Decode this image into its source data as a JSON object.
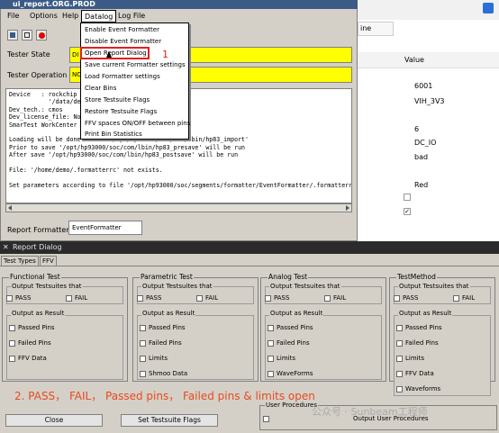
{
  "main_window": {
    "title": "ui_report.ORG.PROD",
    "menu": [
      "File",
      "Options",
      "Help",
      "Datalog",
      "Log File"
    ],
    "tester_state_label": "Tester State",
    "tester_state_value": "DI",
    "tester_operation_label": "Tester Operation",
    "tester_operation_value": "NO",
    "log_lines": [
      "Device   : rockchip on",
      "           '/data/dem",
      "Dev_tech.: cmos",
      "Dev_license_file: None",
      "SmarTest WorkCenter Re",
      "",
      "Loading will be done b  ...  /opt/hp93000/soc/com/lbin/hp83_import'",
      "Prior to save '/opt/hp93000/soc/com/lbin/hp83_presave' will be run",
      "After save '/opt/hp93000/soc/com/lbin/hp83_postsave' will be run",
      "",
      "File: '/home/demo/.formatterrc' not exists.",
      "",
      "Set parameters according to file '/opt/hp93000/soc/segments/formatter/EventFormatter/.formatterrc.dk"
    ],
    "report_formatter_label": "Report Formatter",
    "report_formatter_value": "EventFormatter"
  },
  "datalog_menu": {
    "items": [
      "Enable Event Formatter",
      "Disable Event Formatter",
      "Open Report Dialog",
      "Save current Formatter settings",
      "Load Formatter settings",
      "Clear Bins",
      "Store Testsuite Flags",
      "Restore Testsuite Flags",
      "FFV spaces ON/OFF between pins",
      "Print Bin Statistics"
    ],
    "marker": "1"
  },
  "right_panel": {
    "tab_fragment": "ine",
    "column_header": "Value",
    "values": [
      "6001",
      "VIH_3V3",
      "",
      "6",
      "DC_IO",
      "bad",
      "",
      "Red"
    ]
  },
  "report_dialog": {
    "title": "Report Dialog",
    "tabs": [
      "Test Types",
      "FFV"
    ],
    "groups": [
      {
        "title": "Functional Test",
        "out_title": "Output Testsuites that",
        "pass": "PASS",
        "fail": "FAIL",
        "res_title": "Output as Result",
        "items": [
          "Passed Pins",
          "Failed Pins",
          "FFV Data"
        ]
      },
      {
        "title": "Parametric Test",
        "out_title": "Output Testsuites that",
        "pass": "PASS",
        "fail": "FAIL",
        "res_title": "Output as Result",
        "items": [
          "Passed Pins",
          "Failed Pins",
          "Limits",
          "Shmoo Data"
        ]
      },
      {
        "title": "Analog Test",
        "out_title": "Output Testsuites that",
        "pass": "PASS",
        "fail": "FAIL",
        "res_title": "Output as Result",
        "items": [
          "Passed Pins",
          "Failed Pins",
          "Limits",
          "WaveForms"
        ]
      },
      {
        "title": "TestMethod",
        "out_title": "Output Testsuites that",
        "pass": "PASS",
        "fail": "FAIL",
        "res_title": "Output as Result",
        "items": [
          "Passed Pins",
          "Failed Pins",
          "Limits",
          "FFV Data",
          "Waveforms"
        ]
      }
    ],
    "close_button": "Close",
    "set_flags_button": "Set Testsuite Flags",
    "user_procedures_title": "User Procedures",
    "output_user_procedures": "Output User Procedures"
  },
  "annotation": "2. PASS， FAIL， Passed pins， Failed pins & limits open",
  "watermark": "公众号 · Sunbeam工程师"
}
